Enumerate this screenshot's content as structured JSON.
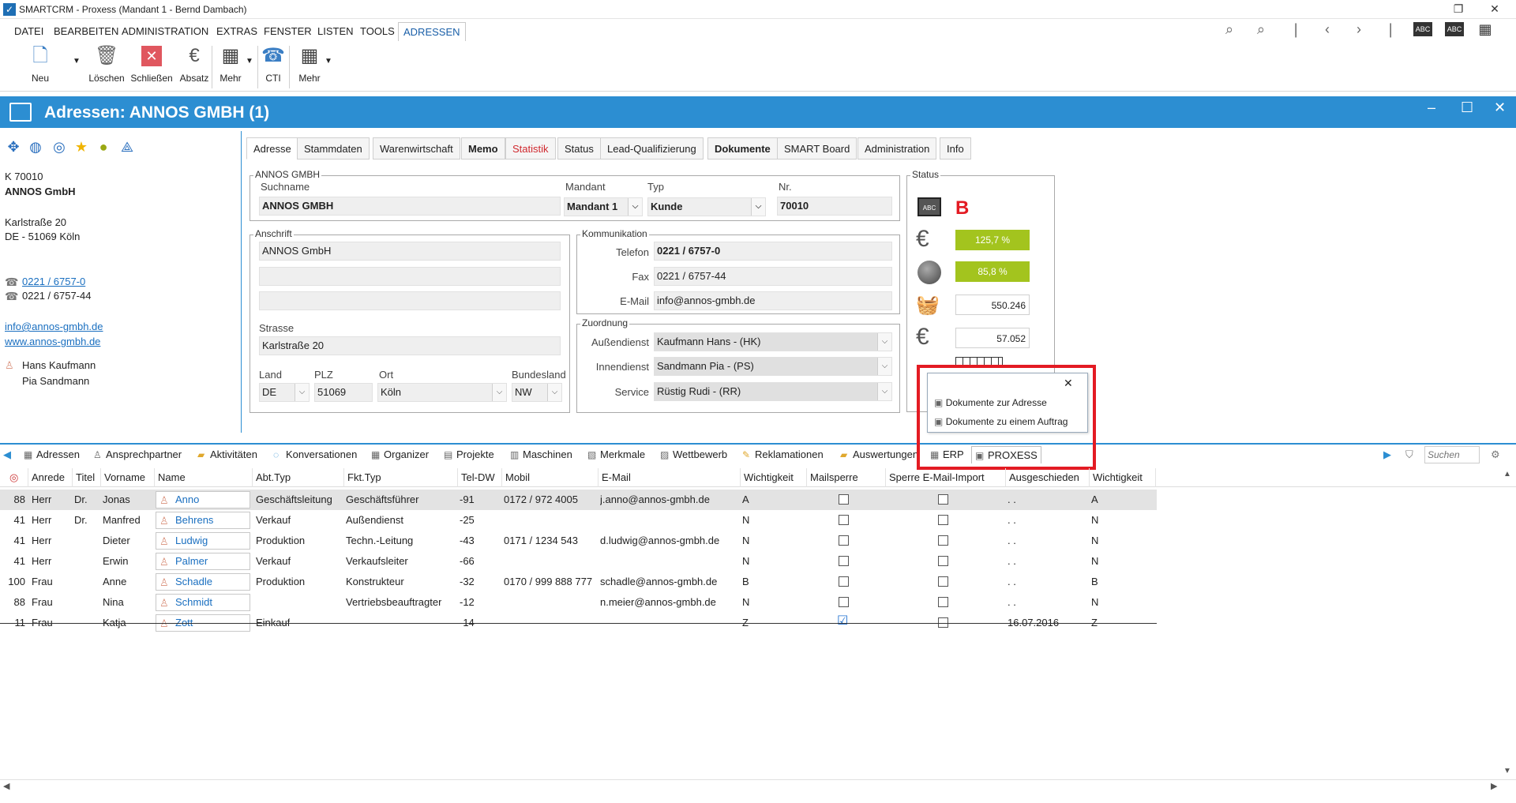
{
  "window": {
    "title": "SMARTCRM - Proxess (Mandant 1 - Bernd Dambach)",
    "minimize": "–",
    "restore": "❐",
    "close": "✕"
  },
  "menu": [
    "DATEI",
    "BEARBEITEN",
    "ADMINISTRATION",
    "EXTRAS",
    "FENSTER",
    "LISTEN",
    "TOOLS",
    "ADRESSEN"
  ],
  "ribbon": {
    "new": "Neu",
    "delete": "Löschen",
    "close": "Schließen",
    "absatz": "Absatz",
    "more1": "Mehr",
    "cti": "CTI",
    "more2": "Mehr"
  },
  "header": {
    "title": "Adressen: ANNOS GMBH (1)",
    "minimize": "–",
    "restore": "☐",
    "close": "✕"
  },
  "left": {
    "kundennr": "K 70010",
    "name": "ANNOS GmbH",
    "street": "Karlstraße 20",
    "city": "DE - 51069 Köln",
    "phone": "0221 / 6757-0",
    "fax": "0221 / 6757-44",
    "email": "info@annos-gmbh.de",
    "web": "www.annos-gmbh.de",
    "contact1": "Hans Kaufmann",
    "contact2": "Pia Sandmann"
  },
  "tabs": [
    "Adresse",
    "Stammdaten",
    "Warenwirtschaft",
    "Memo",
    "Statistik",
    "Status",
    "Lead-Qualifizierung",
    "Dokumente",
    "SMART Board",
    "Administration",
    "Info"
  ],
  "form": {
    "group_title": "ANNOS GMBH",
    "suchname_label": "Suchname",
    "suchname": "ANNOS GMBH",
    "mandant_label": "Mandant",
    "mandant": "Mandant 1",
    "typ_label": "Typ",
    "typ": "Kunde",
    "nr_label": "Nr.",
    "nr": "70010",
    "anschrift_title": "Anschrift",
    "name1": "ANNOS GmbH",
    "strasse_label": "Strasse",
    "strasse": "Karlstraße 20",
    "land_label": "Land",
    "land": "DE",
    "plz_label": "PLZ",
    "plz": "51069",
    "ort_label": "Ort",
    "ort": "Köln",
    "bundesland_label": "Bundesland",
    "bundesland": "NW",
    "komm_title": "Kommunikation",
    "telefon_label": "Telefon",
    "telefon": "0221 / 6757-0",
    "fax_label": "Fax",
    "fax": "0221 / 6757-44",
    "email_label": "E-Mail",
    "email": "info@annos-gmbh.de",
    "zuord_title": "Zuordnung",
    "ad_label": "Außendienst",
    "ad": "Kaufmann Hans - (HK)",
    "id_label": "Innendienst",
    "id": "Sandmann Pia - (PS)",
    "service_label": "Service",
    "service": "Rüstig Rudi - (RR)"
  },
  "status": {
    "title": "Status",
    "grade": "B",
    "pct1": "125,7 %",
    "pct2": "85,8 %",
    "val1": "550.246",
    "val2": "57.052",
    "pct1_value": 125.7,
    "pct2_value": 85.8
  },
  "popup": {
    "close": "✕",
    "item1": "Dokumente zur Adresse",
    "item2": "Dokumente zu einem Auftrag"
  },
  "bottom_tabs": [
    "Adressen",
    "Ansprechpartner",
    "Aktivitäten",
    "Konversationen",
    "Organizer",
    "Projekte",
    "Maschinen",
    "Merkmale",
    "Wettbewerb",
    "Reklamationen",
    "Auswertungen",
    "ERP",
    "PROXESS"
  ],
  "search_placeholder": "Suchen",
  "grid": {
    "columns": [
      "Anrede",
      "Titel",
      "Vorname",
      "Name",
      "Abt.Typ",
      "Fkt.Typ",
      "Tel-DW",
      "Mobil",
      "E-Mail",
      "Wichtigkeit",
      "Mailsperre",
      "Sperre E-Mail-Import",
      "Ausgeschieden",
      "Wichtigkeit"
    ],
    "rows": [
      {
        "score": "88",
        "anrede": "Herr",
        "titel": "Dr.",
        "vorname": "Jonas",
        "name": "Anno",
        "abt": "Geschäftsleitung",
        "fkt": "Geschäftsführer",
        "tel": "-91",
        "mobil": "0172 / 972 4005",
        "email": "j.anno@annos-gmbh.de",
        "wicht": "A",
        "aus": ". .",
        "wicht2": "A",
        "mail": false
      },
      {
        "score": "41",
        "anrede": "Herr",
        "titel": "Dr.",
        "vorname": "Manfred",
        "name": "Behrens",
        "abt": "Verkauf",
        "fkt": "Außendienst",
        "tel": "-25",
        "mobil": "",
        "email": "",
        "wicht": "N",
        "aus": ". .",
        "wicht2": "N",
        "mail": false
      },
      {
        "score": "41",
        "anrede": "Herr",
        "titel": "",
        "vorname": "Dieter",
        "name": "Ludwig",
        "abt": "Produktion",
        "fkt": "Techn.-Leitung",
        "tel": "-43",
        "mobil": "0171 / 1234 543",
        "email": "d.ludwig@annos-gmbh.de",
        "wicht": "N",
        "aus": ". .",
        "wicht2": "N",
        "mail": false
      },
      {
        "score": "41",
        "anrede": "Herr",
        "titel": "",
        "vorname": "Erwin",
        "name": "Palmer",
        "abt": "Verkauf",
        "fkt": "Verkaufsleiter",
        "tel": "-66",
        "mobil": "",
        "email": "",
        "wicht": "N",
        "aus": ". .",
        "wicht2": "N",
        "mail": false
      },
      {
        "score": "100",
        "anrede": "Frau",
        "titel": "",
        "vorname": "Anne",
        "name": "Schadle",
        "abt": "Produktion",
        "fkt": "Konstrukteur",
        "tel": "-32",
        "mobil": "0170 / 999 888 777",
        "email": "schadle@annos-gmbh.de",
        "wicht": "B",
        "aus": ". .",
        "wicht2": "B",
        "mail": false
      },
      {
        "score": "88",
        "anrede": "Frau",
        "titel": "",
        "vorname": "Nina",
        "name": "Schmidt",
        "abt": "",
        "fkt": "Vertriebsbeauftragter",
        "tel": "-12",
        "mobil": "",
        "email": "n.meier@annos-gmbh.de",
        "wicht": "N",
        "aus": ". .",
        "wicht2": "N",
        "mail": false
      },
      {
        "score": "11",
        "anrede": "Frau",
        "titel": "",
        "vorname": "Katja",
        "name": "Zott",
        "abt": "Einkauf",
        "fkt": "",
        "tel": "-14",
        "mobil": "",
        "email": "",
        "wicht": "Z",
        "aus": "16.07.2016",
        "wicht2": "Z",
        "mail": true
      }
    ]
  }
}
